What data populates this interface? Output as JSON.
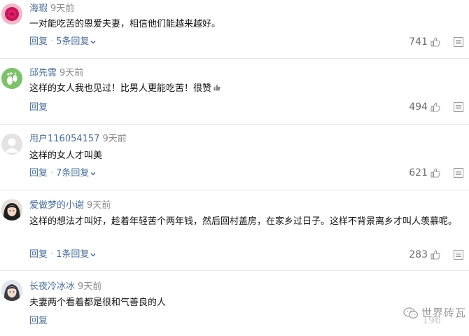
{
  "comments": [
    {
      "username": "海瑕",
      "time": "9天前",
      "text": "一对能吃苦的恩爱夫妻，相信他们能越来越好。",
      "reply_label": "回复",
      "separator": "·",
      "replies_label": "5条回复",
      "likes": "741",
      "avatar": "rose-avatar"
    },
    {
      "username": "邱先雲",
      "time": "9天前",
      "text": "这样的女人我也见过！比男人更能吃苦！很赞",
      "reply_label": "回复",
      "likes": "494",
      "avatar": "footprint-avatar"
    },
    {
      "username": "用户116054157",
      "time": "9天前",
      "text": "这样的女人才叫美",
      "reply_label": "回复",
      "separator": "·",
      "replies_label": "7条回复",
      "likes": "621",
      "avatar": "default-user-avatar"
    },
    {
      "username": "爱做梦的小谢",
      "time": "9天前",
      "text": "这样的想法才叫好，趁着年轻苦个两年钱，然后回村盖房，在家乡过日子。这样不背景离乡才叫人羡慕呢。",
      "reply_label": "回复",
      "separator": "·",
      "replies_label": "1条回复",
      "likes": "283",
      "avatar": "portrait-avatar"
    },
    {
      "username": "长夜冷冰冰",
      "time": "9天前",
      "text": "夫妻两个看着都是很和气善良的人",
      "reply_label": "回复",
      "likes": "196",
      "avatar": "portrait-avatar"
    }
  ],
  "watermark": "世界砖瓦",
  "colors": {
    "link": "#4a6f99",
    "muted": "#8a8a8a",
    "divider": "#e6e6e6"
  }
}
